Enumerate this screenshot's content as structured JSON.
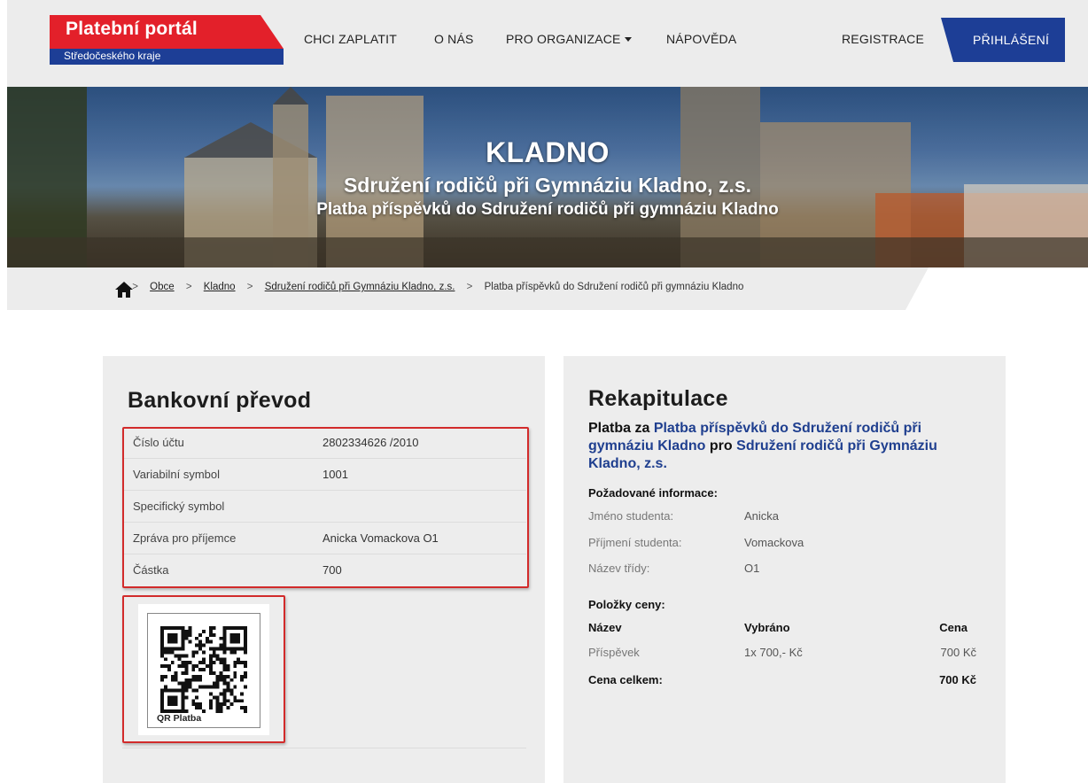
{
  "header": {
    "logo_title": "Platební portál",
    "logo_subtitle": "Středočeského kraje",
    "nav": {
      "pay": "CHCI ZAPLATIT",
      "about": "O NÁS",
      "orgs": "PRO ORGANIZACE",
      "help": "NÁPOVĚDA",
      "register": "REGISTRACE",
      "login": "PŘIHLÁŠENÍ"
    },
    "colors": {
      "brand_red": "#e3202a",
      "brand_blue": "#1d3e96"
    }
  },
  "hero": {
    "title": "KLADNO",
    "subtitle1": "Sdružení rodičů při Gymnáziu Kladno, z.s.",
    "subtitle2": "Platba příspěvků do Sdružení rodičů při gymnáziu Kladno"
  },
  "breadcrumb": {
    "home_icon": "home-icon",
    "separator": ">",
    "items": [
      "Obce",
      "Kladno",
      "Sdružení rodičů při Gymnáziu Kladno, z.s."
    ],
    "current": "Platba příspěvků do Sdružení rodičů při gymnáziu Kladno"
  },
  "bank": {
    "title": "Bankovní převod",
    "rows": [
      {
        "label": "Číslo účtu",
        "value": "2802334626 /2010"
      },
      {
        "label": "Variabilní symbol",
        "value": "1001"
      },
      {
        "label": "Specifický symbol",
        "value": ""
      },
      {
        "label": "Zpráva pro příjemce",
        "value": "Anicka Vomackova O1"
      },
      {
        "label": "Částka",
        "value": "700"
      }
    ],
    "qr_label": "QR Platba",
    "highlight_color": "#d22b2b"
  },
  "recap": {
    "title": "Rekapitulace",
    "line_prefix": "Platba za",
    "line_payment": "Platba příspěvků do Sdružení rodičů při gymnáziu Kladno",
    "line_mid": "pro",
    "line_org": "Sdružení rodičů při Gymnáziu Kladno, z.s.",
    "required_title": "Požadované informace:",
    "info": [
      {
        "label": "Jméno studenta:",
        "value": "Anicka"
      },
      {
        "label": "Příjmení studenta:",
        "value": "Vomackova"
      },
      {
        "label": "Název třídy:",
        "value": "O1"
      }
    ],
    "price_title": "Položky ceny:",
    "price_headers": {
      "name": "Název",
      "selected": "Vybráno",
      "price": "Cena"
    },
    "price_items": [
      {
        "name": "Příspěvek",
        "selected": "1x 700,- Kč",
        "price": "700 Kč"
      }
    ],
    "total_label": "Cena celkem:",
    "total_value": "700 Kč"
  }
}
